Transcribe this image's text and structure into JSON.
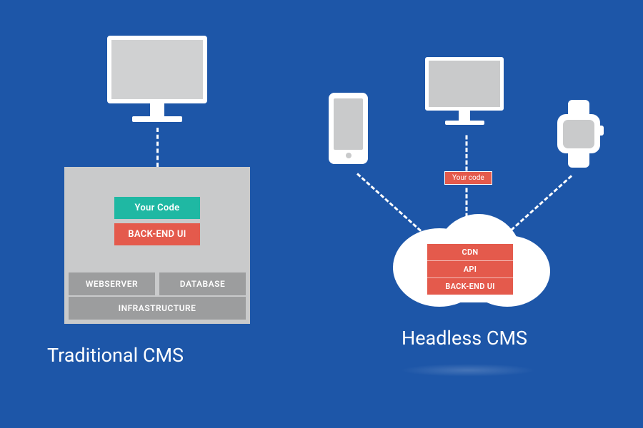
{
  "traditional": {
    "title": "Traditional CMS",
    "your_code": "Your Code",
    "backend_ui": "BACK-END UI",
    "webserver": "WEBSERVER",
    "database": "DATABASE",
    "infrastructure": "INFRASTRUCTURE"
  },
  "headless": {
    "title": "Headless CMS",
    "your_code": "Your code",
    "cdn": "CDN",
    "api": "API",
    "backend_ui": "BACK-END UI"
  }
}
